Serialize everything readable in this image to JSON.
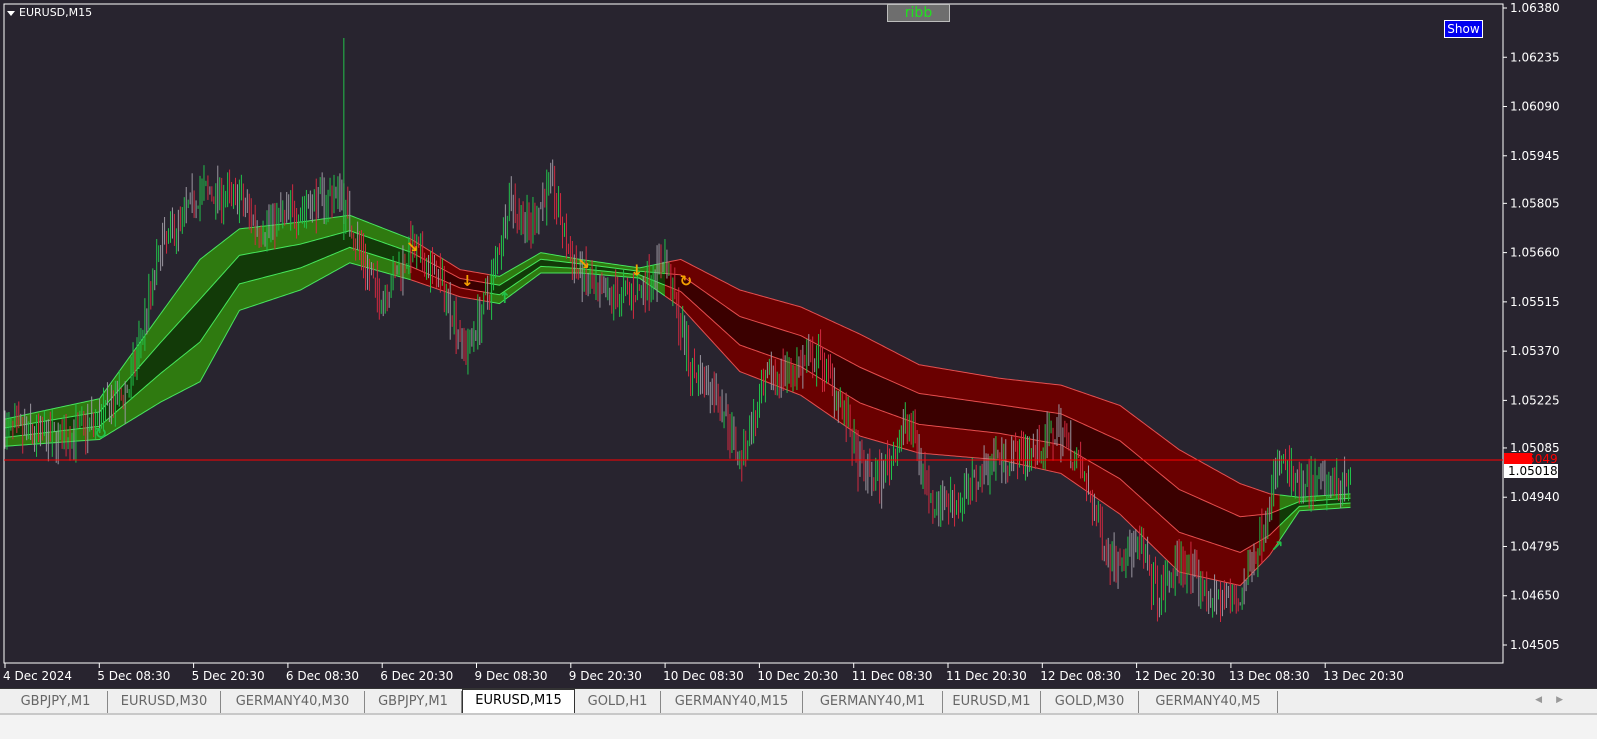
{
  "window": {
    "symbol_title": "EURUSD,M15"
  },
  "buttons": {
    "ribb": "ribb",
    "show": "Show"
  },
  "colors": {
    "background": "#28242f",
    "bull": "#22c04a",
    "bear": "#d02a40",
    "neutral": "#9a96a0",
    "ribbon_green": "#2f7a10",
    "ribbon_green_dark": "#123a08",
    "ribbon_red": "#6a0000",
    "ribbon_red_dark": "#3a0000",
    "current_price": "#ff0000",
    "signal_orange": "#f5a000",
    "signal_green": "#22c04a"
  },
  "price_axis": [
    "1.06380",
    "1.06235",
    "1.06090",
    "1.05945",
    "1.05805",
    "1.05660",
    "1.05515",
    "1.05370",
    "1.05225",
    "1.05085",
    "1.04940",
    "1.04795",
    "1.04650",
    "1.04505"
  ],
  "current_price": {
    "bid": "1.05049",
    "value": "1.05018"
  },
  "time_axis": [
    "4 Dec 2024",
    "5 Dec 08:30",
    "5 Dec 20:30",
    "6 Dec 08:30",
    "6 Dec 20:30",
    "9 Dec 08:30",
    "9 Dec 20:30",
    "10 Dec 08:30",
    "10 Dec 20:30",
    "11 Dec 08:30",
    "11 Dec 20:30",
    "12 Dec 08:30",
    "12 Dec 20:30",
    "13 Dec 08:30",
    "13 Dec 20:30"
  ],
  "tabs": [
    {
      "label": "GBPJPY,M1"
    },
    {
      "label": "EURUSD,M30"
    },
    {
      "label": "GERMANY40,M30"
    },
    {
      "label": "GBPJPY,M1"
    },
    {
      "label": "EURUSD,M15",
      "active": true
    },
    {
      "label": "GOLD,H1"
    },
    {
      "label": "GERMANY40,M15"
    },
    {
      "label": "GERMANY40,M1"
    },
    {
      "label": "EURUSD,M1"
    },
    {
      "label": "GOLD,M30"
    },
    {
      "label": "GERMANY40,M5"
    }
  ],
  "chart_data": {
    "type": "candlestick",
    "symbol": "EURUSD",
    "timeframe": "M15",
    "ylim": [
      1.04505,
      1.0638
    ],
    "close_path": [
      [
        0,
        1.0514
      ],
      [
        28,
        1.0511
      ],
      [
        48,
        1.0517
      ],
      [
        63,
        1.0526
      ],
      [
        79,
        1.0567
      ],
      [
        99,
        1.0584
      ],
      [
        119,
        1.0582
      ],
      [
        129,
        1.0573
      ],
      [
        150,
        1.0579
      ],
      [
        170,
        1.0584
      ],
      [
        178,
        1.057
      ],
      [
        190,
        1.0552
      ],
      [
        206,
        1.0567
      ],
      [
        221,
        1.0558
      ],
      [
        234,
        1.0537
      ],
      [
        246,
        1.0555
      ],
      [
        256,
        1.0582
      ],
      [
        266,
        1.0573
      ],
      [
        277,
        1.0587
      ],
      [
        287,
        1.0564
      ],
      [
        302,
        1.0552
      ],
      [
        322,
        1.0555
      ],
      [
        335,
        1.0564
      ],
      [
        348,
        1.0532
      ],
      [
        363,
        1.0523
      ],
      [
        373,
        1.0505
      ],
      [
        388,
        1.0529
      ],
      [
        414,
        1.0535
      ],
      [
        424,
        1.0523
      ],
      [
        434,
        1.0502
      ],
      [
        444,
        1.0499
      ],
      [
        459,
        1.0517
      ],
      [
        470,
        1.0493
      ],
      [
        485,
        1.0493
      ],
      [
        500,
        1.0505
      ],
      [
        525,
        1.0508
      ],
      [
        536,
        1.0514
      ],
      [
        546,
        1.0502
      ],
      [
        561,
        1.0476
      ],
      [
        576,
        1.0479
      ],
      [
        586,
        1.0464
      ],
      [
        596,
        1.0476
      ],
      [
        612,
        1.0464
      ],
      [
        627,
        1.0464
      ],
      [
        637,
        1.0482
      ],
      [
        647,
        1.0505
      ],
      [
        657,
        1.0496
      ],
      [
        678,
        1.0499
      ],
      [
        683,
        1.0503
      ]
    ],
    "ribbon": [
      [
        0,
        1.0513,
        0.0004
      ],
      [
        48,
        1.0517,
        0.0006
      ],
      [
        79,
        1.0535,
        0.0013
      ],
      [
        99,
        1.0546,
        0.0018
      ],
      [
        119,
        1.0561,
        0.0012
      ],
      [
        150,
        1.0565,
        0.001
      ],
      [
        175,
        1.057,
        0.0007
      ],
      [
        206,
        1.0564,
        0.0006
      ],
      [
        231,
        1.0557,
        0.0004
      ],
      [
        251,
        1.0555,
        0.0004
      ],
      [
        272,
        1.0563,
        0.0003
      ],
      [
        292,
        1.0562,
        0.0002
      ],
      [
        322,
        1.056,
        0.00015
      ],
      [
        343,
        1.0557,
        0.0007
      ],
      [
        373,
        1.0543,
        0.0012
      ],
      [
        404,
        1.0537,
        0.0013
      ],
      [
        434,
        1.0527,
        0.0015
      ],
      [
        464,
        1.052,
        0.0013
      ],
      [
        505,
        1.0517,
        0.0012
      ],
      [
        536,
        1.0514,
        0.0013
      ],
      [
        566,
        1.0505,
        0.0016
      ],
      [
        596,
        1.049,
        0.0018
      ],
      [
        627,
        1.0483,
        0.0015
      ],
      [
        642,
        1.0486,
        0.0009
      ],
      [
        657,
        1.0492,
        0.0002
      ],
      [
        683,
        1.0493,
        0.0002
      ]
    ],
    "trend_segments": [
      {
        "from": 0,
        "to": 206,
        "dir": "up"
      },
      {
        "from": 206,
        "to": 246,
        "dir": "down"
      },
      {
        "from": 246,
        "to": 335,
        "dir": "up"
      },
      {
        "from": 335,
        "to": 647,
        "dir": "down"
      },
      {
        "from": 647,
        "to": 683,
        "dir": "up"
      }
    ],
    "signals": [
      {
        "bar": 48,
        "price": 1.0513,
        "type": "green-circle"
      },
      {
        "bar": 206,
        "price": 1.0568,
        "type": "orange-down-right"
      },
      {
        "bar": 234,
        "price": 1.0558,
        "type": "orange-down"
      },
      {
        "bar": 253,
        "price": 1.0553,
        "type": "green-up"
      },
      {
        "bar": 293,
        "price": 1.0563,
        "type": "orange-down-right"
      },
      {
        "bar": 320,
        "price": 1.0561,
        "type": "orange-down"
      },
      {
        "bar": 345,
        "price": 1.0558,
        "type": "orange-circle"
      },
      {
        "bar": 645,
        "price": 1.048,
        "type": "green-up-right"
      }
    ]
  }
}
